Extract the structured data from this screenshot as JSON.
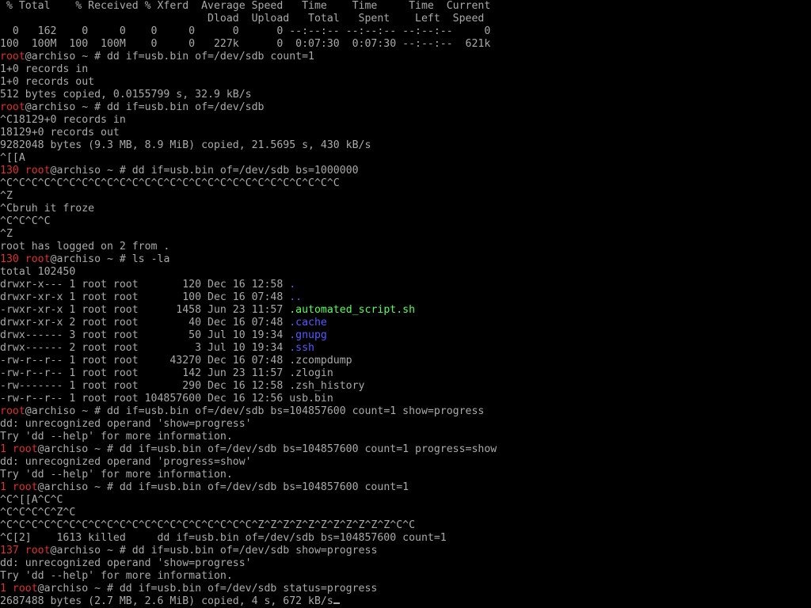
{
  "colors": {
    "background": "#000000",
    "default_text": "#aaaaaa",
    "prompt_user": "#e03030",
    "executable": "#55ff55",
    "directory": "#5858ff"
  },
  "lines": [
    [
      {
        "t": " % Total    % Received % Xferd  Average Speed   Time    Time     Time  Current"
      }
    ],
    [
      {
        "t": "                                 Dload  Upload   Total   Spent    Left  Speed"
      }
    ],
    [
      {
        "t": "  0   162    0     0    0     0      0      0 --:--:-- --:--:-- --:--:--     0"
      }
    ],
    [
      {
        "t": "100  100M  100  100M    0     0   227k      0  0:07:30  0:07:30 --:--:--  621k"
      }
    ],
    [
      {
        "t": "root",
        "c": "red"
      },
      {
        "t": "@archiso ~ # dd if=usb.bin of=/dev/sdb count=1"
      }
    ],
    [
      {
        "t": "1+0 records in"
      }
    ],
    [
      {
        "t": "1+0 records out"
      }
    ],
    [
      {
        "t": "512 bytes copied, 0.0155799 s, 32.9 kB/s"
      }
    ],
    [
      {
        "t": "root",
        "c": "red"
      },
      {
        "t": "@archiso ~ # dd if=usb.bin of=/dev/sdb"
      }
    ],
    [
      {
        "t": "^C18129+0 records in"
      }
    ],
    [
      {
        "t": "18129+0 records out"
      }
    ],
    [
      {
        "t": "9282048 bytes (9.3 MB, 8.9 MiB) copied, 21.5695 s, 430 kB/s"
      }
    ],
    [
      {
        "t": "^[[A"
      }
    ],
    [
      {
        "t": "130 root",
        "c": "red"
      },
      {
        "t": "@archiso ~ # dd if=usb.bin of=/dev/sdb bs=1000000"
      }
    ],
    [
      {
        "t": "^C^C^C^C^C^C^C^C^C^C^C^C^C^C^C^C^C^C^C^C^C^C^C^C^C^C^C"
      }
    ],
    [
      {
        "t": "^Z"
      }
    ],
    [
      {
        "t": "^Cbruh it froze"
      }
    ],
    [
      {
        "t": "^C^C^C^C"
      }
    ],
    [
      {
        "t": "^Z"
      }
    ],
    [
      {
        "t": "root has logged on 2 from ."
      }
    ],
    [
      {
        "t": "130 root",
        "c": "red"
      },
      {
        "t": "@archiso ~ # ls -la"
      }
    ],
    [
      {
        "t": "total 102450"
      }
    ],
    [
      {
        "t": "drwxr-x--- 1 root root       120 Dec 16 12:58 "
      },
      {
        "t": ".",
        "c": "blue"
      }
    ],
    [
      {
        "t": "drwxr-xr-x 1 root root       100 Dec 16 07:48 "
      },
      {
        "t": "..",
        "c": "blue"
      }
    ],
    [
      {
        "t": "-rwxr-xr-x 1 root root      1458 Jun 23 11:57 "
      },
      {
        "t": ".automated_script.sh",
        "c": "green"
      }
    ],
    [
      {
        "t": "drwxr-xr-x 2 root root        40 Dec 16 07:48 "
      },
      {
        "t": ".cache",
        "c": "blue"
      }
    ],
    [
      {
        "t": "drwx------ 3 root root        50 Jul 10 19:34 "
      },
      {
        "t": ".gnupg",
        "c": "blue"
      }
    ],
    [
      {
        "t": "drwx------ 2 root root         3 Jul 10 19:34 "
      },
      {
        "t": ".ssh",
        "c": "blue"
      }
    ],
    [
      {
        "t": "-rw-r--r-- 1 root root     43270 Dec 16 07:48 .zcompdump"
      }
    ],
    [
      {
        "t": "-rw-r--r-- 1 root root       142 Jun 23 11:57 .zlogin"
      }
    ],
    [
      {
        "t": "-rw------- 1 root root       290 Dec 16 12:58 .zsh_history"
      }
    ],
    [
      {
        "t": "-rw-r--r-- 1 root root 104857600 Dec 16 12:56 usb.bin"
      }
    ],
    [
      {
        "t": "root",
        "c": "red"
      },
      {
        "t": "@archiso ~ # dd if=usb.bin of=/dev/sdb bs=104857600 count=1 show=progress"
      }
    ],
    [
      {
        "t": "dd: unrecognized operand 'show=progress'"
      }
    ],
    [
      {
        "t": "Try 'dd --help' for more information."
      }
    ],
    [
      {
        "t": "1 root",
        "c": "red"
      },
      {
        "t": "@archiso ~ # dd if=usb.bin of=/dev/sdb bs=104857600 count=1 progress=show"
      }
    ],
    [
      {
        "t": "dd: unrecognized operand 'progress=show'"
      }
    ],
    [
      {
        "t": "Try 'dd --help' for more information."
      }
    ],
    [
      {
        "t": "1 root",
        "c": "red"
      },
      {
        "t": "@archiso ~ # dd if=usb.bin of=/dev/sdb bs=104857600 count=1"
      }
    ],
    [
      {
        "t": "^C^[[A^C^C"
      }
    ],
    [
      {
        "t": "^C^C^C^C^Z^C"
      }
    ],
    [
      {
        "t": "^C^C^C^C^C^C^C^C^C^C^C^C^C^C^C^C^C^C^C^C^Z^Z^Z^Z^Z^Z^Z^Z^Z^Z^Z^C^C"
      }
    ],
    [
      {
        "t": "^C[2]    1613 killed     dd if=usb.bin of=/dev/sdb bs=104857600 count=1"
      }
    ],
    [
      {
        "t": "137 root",
        "c": "red"
      },
      {
        "t": "@archiso ~ # dd if=usb.bin of=/dev/sdb show=progress"
      }
    ],
    [
      {
        "t": "dd: unrecognized operand 'show=progress'"
      }
    ],
    [
      {
        "t": "Try 'dd --help' for more information."
      }
    ],
    [
      {
        "t": "1 root",
        "c": "red"
      },
      {
        "t": "@archiso ~ # dd if=usb.bin of=/dev/sdb status=progress"
      }
    ],
    [
      {
        "t": "2687488 bytes (2.7 MB, 2.6 MiB) copied, 4 s, 672 kB/s"
      }
    ]
  ]
}
